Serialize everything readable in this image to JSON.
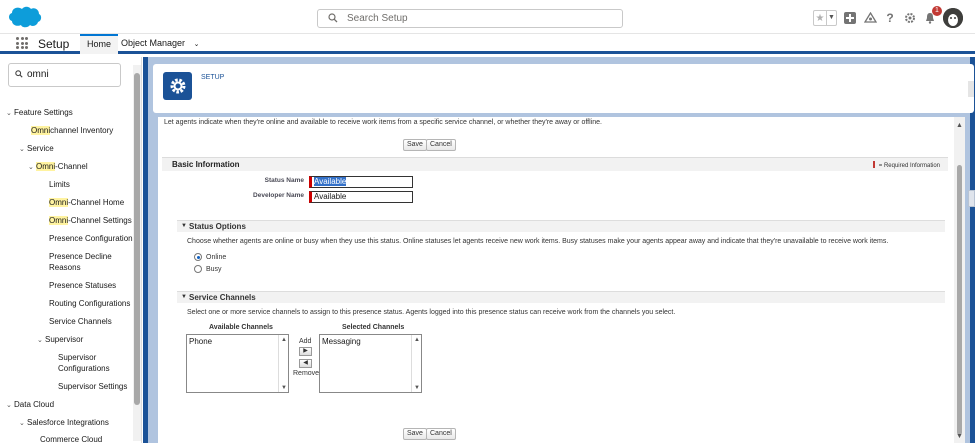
{
  "header": {
    "search_placeholder": "Search Setup",
    "notification_count": "1",
    "icons": [
      "star-icon",
      "add-icon",
      "trailhead-icon",
      "help-icon",
      "gear-icon",
      "bell-icon",
      "avatar"
    ]
  },
  "nav": {
    "app_name": "Setup",
    "tabs": [
      {
        "label": "Home",
        "active": true
      },
      {
        "label": "Object Manager",
        "active": false
      }
    ]
  },
  "sidebar": {
    "search_value": "omni",
    "items": [
      {
        "pre": "",
        "hl": "",
        "post": "Feature Settings"
      },
      {
        "pre": "",
        "hl": "Omni",
        "post": "channel Inventory"
      },
      {
        "pre": "",
        "hl": "",
        "post": "Service"
      },
      {
        "pre": "",
        "hl": "Omni",
        "post": "-Channel"
      },
      {
        "pre": "",
        "hl": "",
        "post": "Limits"
      },
      {
        "pre": "",
        "hl": "Omni",
        "post": "-Channel Home"
      },
      {
        "pre": "",
        "hl": "Omni",
        "post": "-Channel Settings"
      },
      {
        "pre": "",
        "hl": "",
        "post": "Presence Configurations"
      },
      {
        "pre": "",
        "hl": "",
        "post": "Presence Decline"
      },
      {
        "pre": "",
        "hl": "",
        "post": "Reasons"
      },
      {
        "pre": "",
        "hl": "",
        "post": "Presence Statuses"
      },
      {
        "pre": "",
        "hl": "",
        "post": "Routing Configurations"
      },
      {
        "pre": "",
        "hl": "",
        "post": "Service Channels"
      },
      {
        "pre": "",
        "hl": "",
        "post": "Supervisor"
      },
      {
        "pre": "",
        "hl": "",
        "post": "Supervisor"
      },
      {
        "pre": "",
        "hl": "",
        "post": "Configurations"
      },
      {
        "pre": "",
        "hl": "",
        "post": "Supervisor Settings"
      },
      {
        "pre": "",
        "hl": "",
        "post": "Data Cloud"
      },
      {
        "pre": "",
        "hl": "",
        "post": "Salesforce Integrations"
      },
      {
        "pre": "",
        "hl": "",
        "post": "Commerce Cloud"
      }
    ]
  },
  "page": {
    "breadcrumb": "SETUP",
    "intro": "Let agents indicate when they're online and available to receive work items from a specific service channel, or whether they're away or offline.",
    "save_label": "Save",
    "cancel_label": "Cancel",
    "basic_info_title": "Basic Information",
    "required_note": "= Required Information",
    "status_name_label": "Status Name",
    "status_name_value": "Available",
    "developer_name_label": "Developer Name",
    "developer_name_value": "Available",
    "status_options": {
      "title": "Status Options",
      "description": "Choose whether agents are online or busy when they use this status. Online statuses let agents receive new work items. Busy statuses make your agents appear away and indicate that they're unavailable to receive work items.",
      "options": [
        {
          "label": "Online",
          "selected": true
        },
        {
          "label": "Busy",
          "selected": false
        }
      ]
    },
    "service_channels": {
      "title": "Service Channels",
      "description": "Select one or more service channels to assign to this presence status. Agents logged into this presence status can receive work from the channels you select.",
      "available_label": "Available Channels",
      "selected_label": "Selected Channels",
      "available": [
        "Phone"
      ],
      "selected": [
        "Messaging"
      ],
      "add_label": "Add",
      "remove_label": "Remove"
    }
  }
}
